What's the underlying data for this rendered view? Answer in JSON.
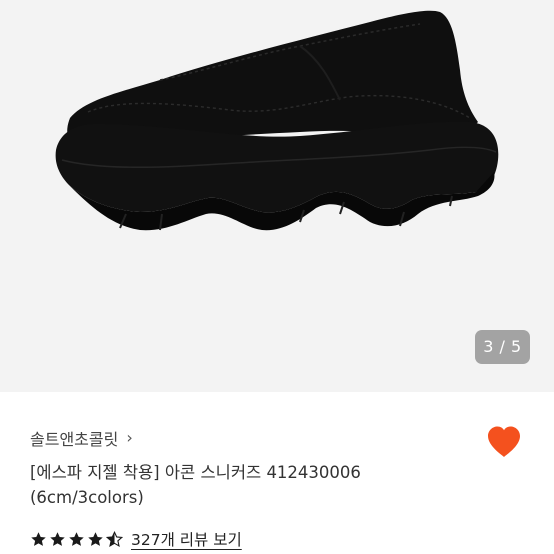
{
  "product": {
    "image_alt": "black platform slip-on sneaker",
    "page_indicator": "3 / 5",
    "store_name": "솔트앤초콜릿",
    "store_chevron_icon": "chevron-right-icon",
    "title_line1": "[에스파 지젤 착용] 아콘 스니커즈 412430006",
    "title_line2": "(6cm/3colors)",
    "rating": 4.5,
    "review_link": "327개 리뷰 보기",
    "favorite_icon": "heart-icon",
    "colors": {
      "heart": "#f4511e",
      "stars": "#1a1a1a",
      "image_bg": "#f3f3f3"
    }
  }
}
